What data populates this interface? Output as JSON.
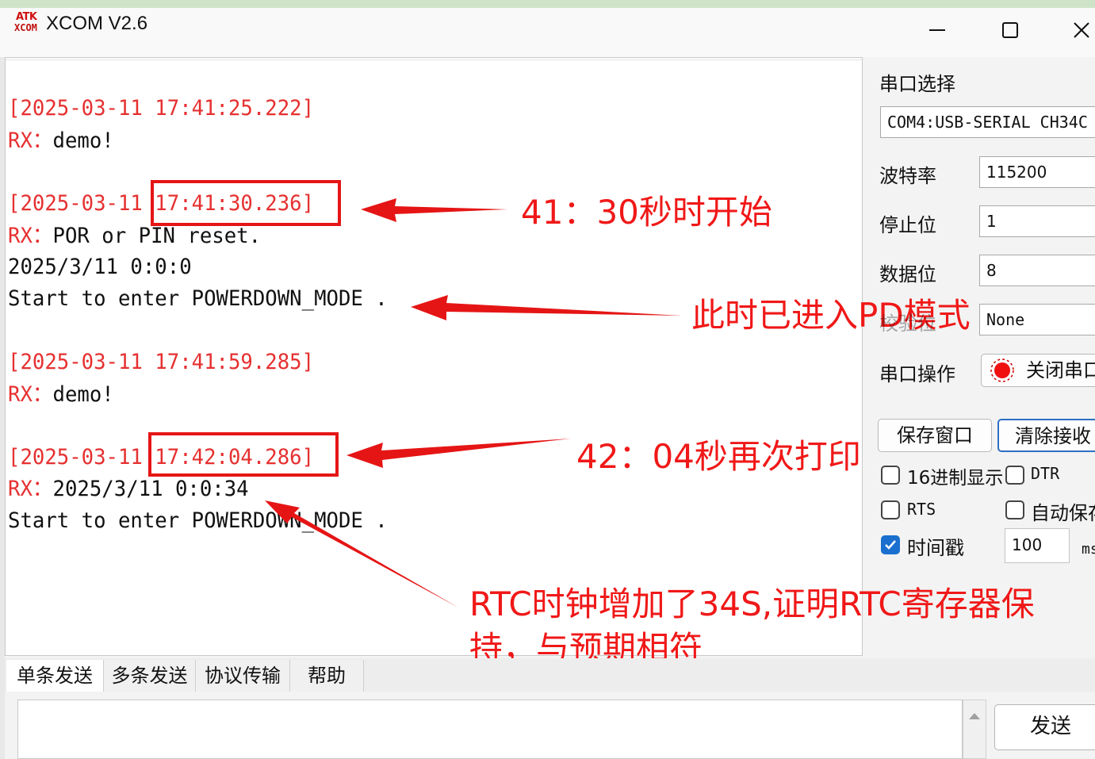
{
  "window": {
    "logo_top": "ATK",
    "logo_bottom": "XCOM",
    "title": "XCOM V2.6"
  },
  "receive": {
    "lines": [
      {
        "text": "[2025-03-11 17:41:25.222]",
        "color": "#e63030"
      },
      {
        "prefix": "RX：",
        "text": "demo!"
      },
      {
        "text": "[2025-03-11 17:41:30.236]",
        "color": "#e63030"
      },
      {
        "prefix": "RX：",
        "text": "POR or PIN reset."
      },
      {
        "text": "2025/3/11 0:0:0"
      },
      {
        "text": "Start to enter POWERDOWN_MODE ."
      },
      {
        "text": "[2025-03-11 17:41:59.285]",
        "color": "#e63030"
      },
      {
        "prefix": "RX：",
        "text": "demo!"
      },
      {
        "text": "[2025-03-11 17:42:04.286]",
        "color": "#e63030"
      },
      {
        "prefix": "RX：",
        "text": "2025/3/11 0:0:34"
      },
      {
        "text": "Start to enter POWERDOWN_MODE ."
      }
    ]
  },
  "annotations": {
    "a1": "41：30秒时开始",
    "a2": "此时已进入PD模式",
    "a3": "42：04秒再次打印",
    "a4_line1": "RTC时钟增加了34S,证明RTC寄存器保",
    "a4_line2": "持，与预期相符",
    "color": "#f01818"
  },
  "panel": {
    "port_select_label": "串口选择",
    "port_value": "COM4:USB-SERIAL CH34C",
    "baud_label": "波特率",
    "baud_value": "115200",
    "stop_label": "停止位",
    "stop_value": "1",
    "data_label": "数据位",
    "data_value": "8",
    "parity_label": "校验位",
    "parity_value": "None",
    "port_op_label": "串口操作",
    "close_port": "关闭串口",
    "save_window": "保存窗口",
    "clear_recv": "清除接收",
    "hex_display": "16进制显示",
    "dtr": "DTR",
    "rts": "RTS",
    "auto_save": "自动保存",
    "timestamp": "时间戳",
    "timestamp_checked": true,
    "interval_value": "100",
    "interval_unit": "ms"
  },
  "tabs": [
    "单条发送",
    "多条发送",
    "协议传输",
    "帮助"
  ],
  "send": {
    "button": "发送"
  }
}
